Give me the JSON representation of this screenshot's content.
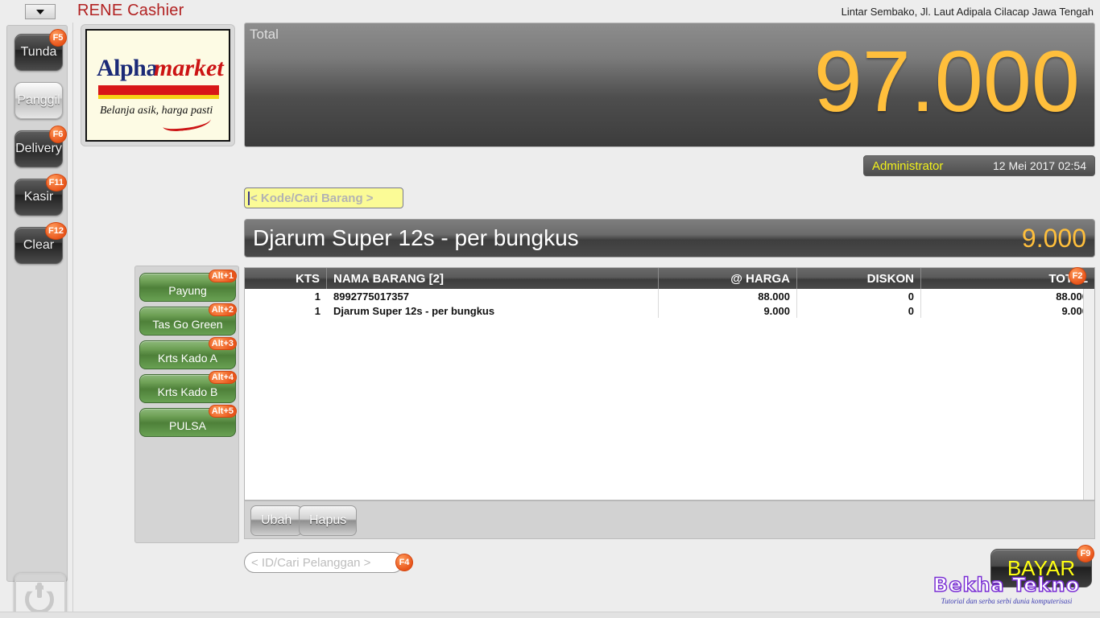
{
  "app": {
    "title": "RENE Cashier",
    "store_info": "Lintar Sembako, Jl. Laut  Adipala Cilacap Jawa Tengah",
    "dropdown_icon": "chevron-down-icon"
  },
  "logo": {
    "word1": "Alpha",
    "word2": "market",
    "tagline": "Belanja asik, harga pasti"
  },
  "sidebar": {
    "buttons": [
      {
        "label": "Tunda",
        "fkey": "F5",
        "style": "dark"
      },
      {
        "label": "Panggil",
        "fkey": "",
        "style": "light"
      },
      {
        "label": "Delivery",
        "fkey": "F6",
        "style": "dark"
      },
      {
        "label": "Kasir",
        "fkey": "F11",
        "style": "dark"
      },
      {
        "label": "Clear",
        "fkey": "F12",
        "style": "dark"
      }
    ],
    "power_icon": "power-icon"
  },
  "total": {
    "label": "Total",
    "value": "97.000"
  },
  "session": {
    "user": "Administrator",
    "datetime": "12 Mei 2017  02:54"
  },
  "search": {
    "code_placeholder": "< Kode/Cari Barang >"
  },
  "current_item": {
    "name": "Djarum Super 12s - per bungkus",
    "price": "9.000"
  },
  "quick_buttons": [
    {
      "label": "Payung",
      "fkey": "Alt+1"
    },
    {
      "label": "Tas Go Green",
      "fkey": "Alt+2"
    },
    {
      "label": "Krts Kado A",
      "fkey": "Alt+3"
    },
    {
      "label": "Krts Kado B",
      "fkey": "Alt+4"
    },
    {
      "label": "PULSA",
      "fkey": "Alt+5"
    }
  ],
  "table": {
    "fkey_badge": "F2",
    "headers": {
      "kts": "KTS",
      "nama": "NAMA BARANG  [2]",
      "harga": "@ HARGA",
      "diskon": "DISKON",
      "total": "TOTAL"
    },
    "rows": [
      {
        "kts": "1",
        "nama": "8992775017357",
        "harga": "88.000",
        "diskon": "0",
        "total": "88.000"
      },
      {
        "kts": "1",
        "nama": "Djarum Super 12s - per bungkus",
        "harga": "9.000",
        "diskon": "0",
        "total": "9.000"
      }
    ]
  },
  "actions": {
    "edit_label": "Ubah",
    "delete_label": "Hapus"
  },
  "customer": {
    "placeholder": "< ID/Cari Pelanggan >",
    "fkey": "F4"
  },
  "pay": {
    "label": "BAYAR",
    "fkey": "F9"
  },
  "watermark": {
    "title": "Bekha Tekno",
    "subtitle": "Tutorial dan serba serbi dunia komputerisasi"
  },
  "colors": {
    "accent_amber": "#ffbf3c",
    "brand_red": "#b22222",
    "badge_orange": "#e8551b",
    "pay_yellow": "#ffff12",
    "user_yellow": "#f2f21a"
  }
}
